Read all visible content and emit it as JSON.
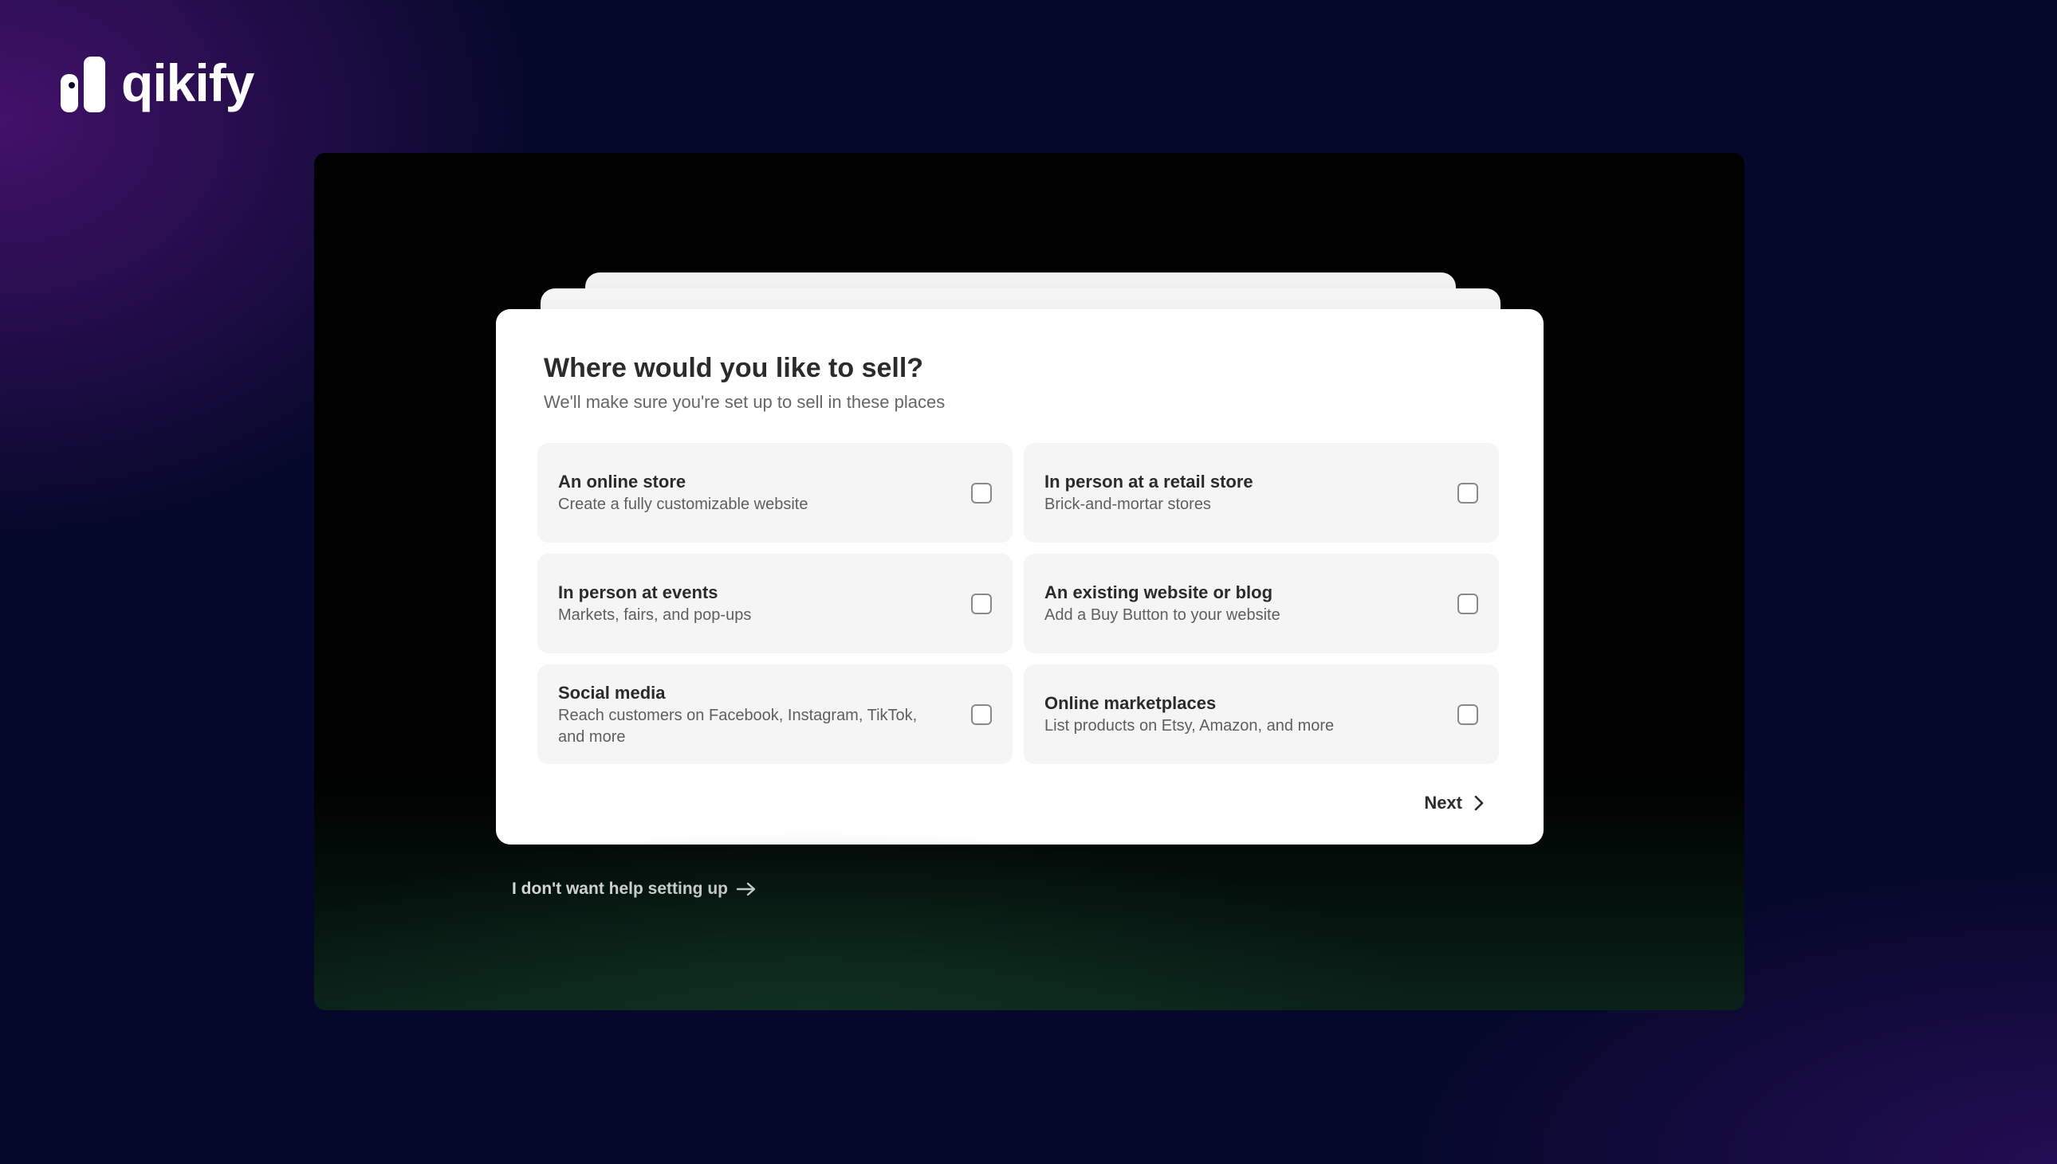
{
  "brand": {
    "name": "qikify",
    "logo_icon": "qikify-logo-icon",
    "colors": {
      "background": "#05082a",
      "accent_purple": "#46126e",
      "card": "#ffffff",
      "option_bg": "#f5f5f5",
      "text": "#2b2b2b"
    }
  },
  "onboarding": {
    "title": "Where would you like to sell?",
    "subtitle": "We'll make sure you're set up to sell in these places",
    "options": [
      {
        "title": "An online store",
        "description": "Create a fully customizable website",
        "checked": false
      },
      {
        "title": "In person at a retail store",
        "description": "Brick-and-mortar stores",
        "checked": false
      },
      {
        "title": "In person at events",
        "description": "Markets, fairs, and pop-ups",
        "checked": false
      },
      {
        "title": "An existing website or blog",
        "description": "Add a Buy Button to your website",
        "checked": false
      },
      {
        "title": "Social media",
        "description": "Reach customers on Facebook, Instagram, TikTok, and more",
        "checked": false
      },
      {
        "title": "Online marketplaces",
        "description": "List products on Etsy, Amazon, and more",
        "checked": false
      }
    ],
    "next_label": "Next",
    "next_icon": "chevron-right-icon",
    "skip_label": "I don't want help setting up",
    "skip_icon": "arrow-right-icon"
  }
}
